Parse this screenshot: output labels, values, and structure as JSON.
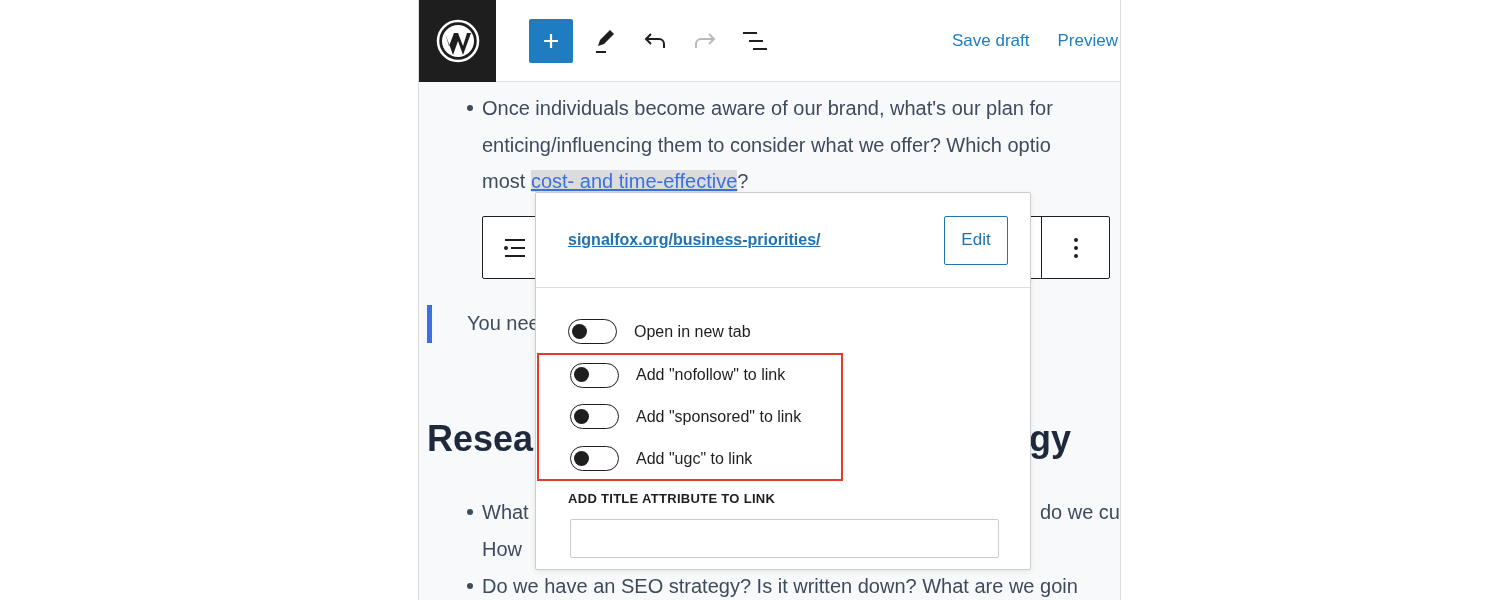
{
  "header": {
    "tools": [
      {
        "kind": "add",
        "disabled": false
      },
      {
        "kind": "pencil",
        "disabled": false
      },
      {
        "kind": "undo",
        "disabled": false
      },
      {
        "kind": "redo",
        "disabled": true
      },
      {
        "kind": "list-view",
        "disabled": false
      }
    ],
    "actions": [
      "Save draft",
      "Preview"
    ]
  },
  "content": [
    {
      "kind": "bullet",
      "lines": [
        {
          "segments": [
            {
              "text": "Once individuals become aware of our brand, what's our plan for"
            }
          ]
        },
        {
          "segments": [
            {
              "text": "enticing/influencing them to consider what we offer? Which optio"
            }
          ]
        },
        {
          "segments": [
            {
              "text": "most "
            },
            {
              "text": "cost- and time-effective",
              "link": true,
              "highlighted": true
            },
            {
              "text": "?"
            }
          ]
        }
      ]
    },
    {
      "kind": "quote",
      "lines": [
        {
          "segments": [
            {
              "text": "You nee"
            }
          ]
        }
      ]
    },
    {
      "kind": "heading",
      "lines": [
        {
          "segments": [
            {
              "text": "Resea"
            }
          ],
          "right": "gy"
        }
      ]
    },
    {
      "kind": "bullet",
      "lines": [
        {
          "segments": [
            {
              "text": "What"
            }
          ],
          "right": "do we cu"
        },
        {
          "segments": [
            {
              "text": "How"
            }
          ]
        }
      ]
    },
    {
      "kind": "bullet",
      "lines": [
        {
          "segments": [
            {
              "text": "Do we have an SEO strategy? Is it written down? What are we goin"
            }
          ]
        }
      ]
    }
  ],
  "popover": {
    "url": "signalfox.org/business-priorities/",
    "edit_label": "Edit",
    "toggles": [
      {
        "label": "Open in new tab",
        "on": false,
        "outlined": false
      },
      {
        "label": "Add \"nofollow\" to link",
        "on": false,
        "outlined": true
      },
      {
        "label": "Add \"sponsored\" to link",
        "on": false,
        "outlined": true
      },
      {
        "label": "Add \"ugc\" to link",
        "on": false,
        "outlined": true
      }
    ],
    "title_field": {
      "label": "ADD TITLE ATTRIBUTE TO LINK"
    }
  }
}
